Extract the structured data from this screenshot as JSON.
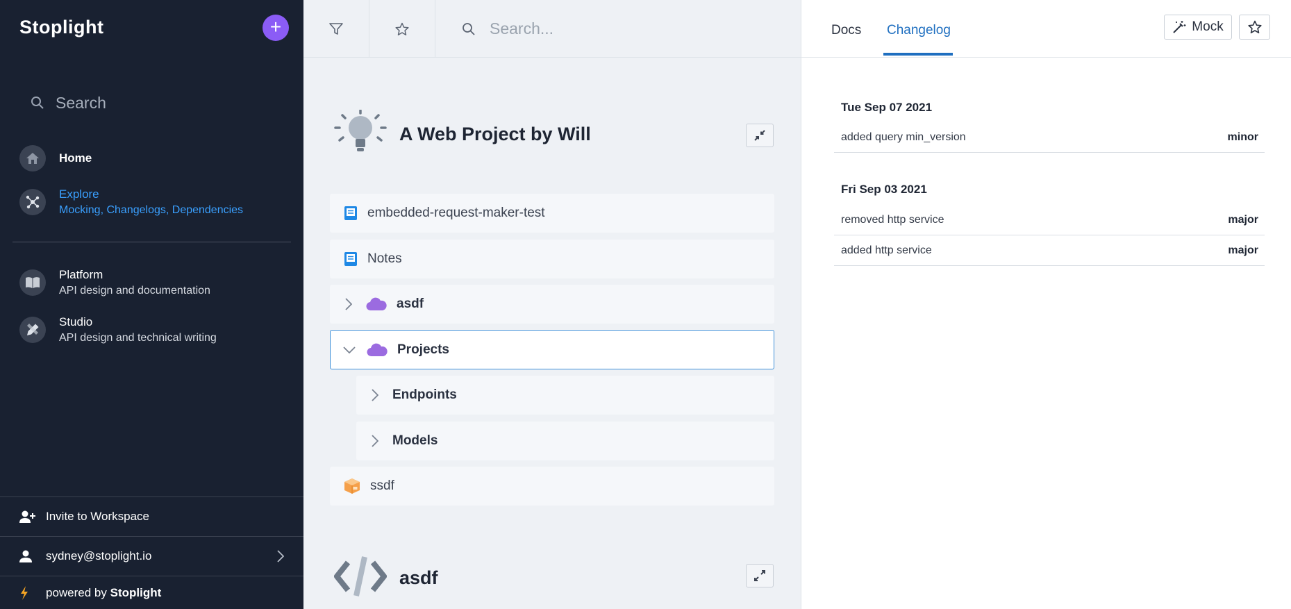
{
  "sidebar": {
    "logo": "Stoplight",
    "add_label": "+",
    "search_label": "Search",
    "nav": [
      {
        "title": "Home",
        "subtitle": ""
      },
      {
        "title": "Explore",
        "subtitle": "Mocking, Changelogs, Dependencies"
      },
      {
        "title": "Platform",
        "subtitle": "API design and documentation"
      },
      {
        "title": "Studio",
        "subtitle": "API design and technical writing"
      }
    ],
    "invite_label": "Invite to Workspace",
    "user_email": "sydney@stoplight.io",
    "powered_prefix": "powered by ",
    "powered_brand": "Stoplight"
  },
  "middle": {
    "search_placeholder": "Search...",
    "project1": {
      "title": "A Web Project by Will",
      "items": [
        {
          "label": "embedded-request-maker-test"
        },
        {
          "label": "Notes"
        },
        {
          "label": "asdf"
        },
        {
          "label": "Projects"
        },
        {
          "label": "Endpoints"
        },
        {
          "label": "Models"
        },
        {
          "label": "ssdf"
        }
      ]
    },
    "project2": {
      "title": "asdf"
    }
  },
  "right": {
    "tabs": [
      "Docs",
      "Changelog"
    ],
    "active_tab": "Changelog",
    "mock_label": "Mock",
    "changelog": [
      {
        "date": "Tue Sep 07 2021",
        "entries": [
          {
            "text": "added query min_version",
            "level": "minor"
          }
        ]
      },
      {
        "date": "Fri Sep 03 2021",
        "entries": [
          {
            "text": "removed http service",
            "level": "major"
          },
          {
            "text": "added http service",
            "level": "major"
          }
        ]
      }
    ]
  },
  "colors": {
    "sidebar_bg": "#192131",
    "accent_purple": "#8b5cf6",
    "active_blue": "#3aa0ff",
    "tab_blue": "#1f6fc0",
    "middle_bg": "#eef1f5"
  }
}
